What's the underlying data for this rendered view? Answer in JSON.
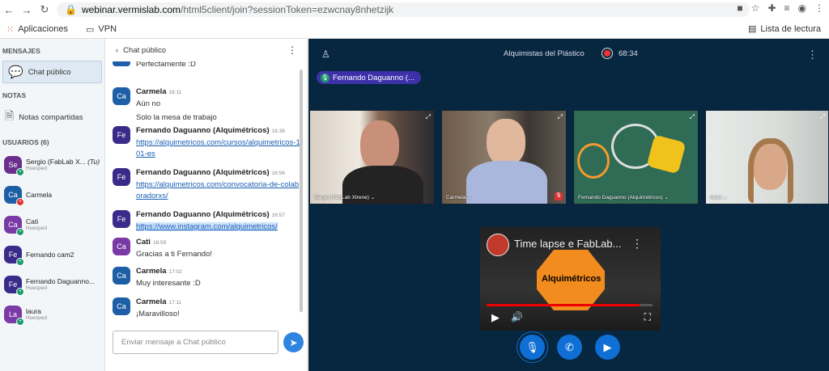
{
  "browser": {
    "url_host": "webinar.vermislab.com",
    "url_path": "/html5client/join?sessionToken=ezwcnay8nhetzijk",
    "bookmarks": [
      "Aplicaciones",
      "VPN"
    ],
    "reading_list": "Lista de lectura"
  },
  "sidebar": {
    "messages_title": "MENSAJES",
    "public_chat": "Chat público",
    "notes_title": "NOTAS",
    "shared_notes": "Notas compartidas",
    "users_title": "USUARIOS (6)",
    "users": [
      {
        "initials": "Se",
        "name": "Sergio (FabLab X...",
        "you": "(Tu)",
        "role": "Huesped",
        "color": "#6a2f8c"
      },
      {
        "initials": "Ca",
        "name": "Carmela",
        "role": "",
        "color": "#1d5fa6"
      },
      {
        "initials": "Ca",
        "name": "Cati",
        "role": "Huesped",
        "color": "#7a3aa6"
      },
      {
        "initials": "Fe",
        "name": "Fernando cam2",
        "role": "",
        "color": "#3a2b8a"
      },
      {
        "initials": "Fe",
        "name": "Fernando Daguanno...",
        "role": "Huesped",
        "color": "#3a2b8a"
      },
      {
        "initials": "La",
        "name": "laura",
        "role": "Huesped",
        "color": "#7a3aa6"
      }
    ]
  },
  "chat": {
    "title": "Chat público",
    "placeholder": "Enviar mensaje a Chat público",
    "messages": [
      {
        "initials": "",
        "name": "",
        "time": "",
        "lines": [
          "Perfectamente :D"
        ]
      },
      {
        "initials": "Ca",
        "name": "Carmela",
        "time": "16:11",
        "lines": [
          "Aún no",
          "Solo la mesa de trabajo"
        ]
      },
      {
        "initials": "Fe",
        "name": "Fernando Daguanno (Alquimétricos)",
        "time": "16:36",
        "link": "https://alquimetricos.com/cursos/alquimetricos-101-es"
      },
      {
        "initials": "Fe",
        "name": "Fernando Daguanno (Alquimétricos)",
        "time": "16:56",
        "link": "https://alquimetricos.com/convocatoria-de-colaboradorxs/"
      },
      {
        "initials": "Fe",
        "name": "Fernando Daguanno (Alquimétricos)",
        "time": "16:57",
        "link": "https://www.instagram.com/alquimetricos/"
      },
      {
        "initials": "Ca",
        "name": "Cati",
        "time": "16:59",
        "lines": [
          "Gracias a ti Fernando!"
        ]
      },
      {
        "initials": "Ca",
        "name": "Carmela",
        "time": "17:02",
        "lines": [
          "Muy interesante :D"
        ]
      },
      {
        "initials": "Ca",
        "name": "Carmela",
        "time": "17:11",
        "lines": [
          "¡Maravilloso!"
        ]
      }
    ]
  },
  "meeting": {
    "title": "Alquimistas del Plástico",
    "timer": "68:34",
    "presenter": "Fernando Daguanno (...",
    "tiles": [
      "Sergio (FabLab Xtrene) ⌄",
      "Carmela ⌄",
      "Fernando Daguanno (Alquimétricos) ⌄",
      "laura ⌄"
    ],
    "video_title": "Time lapse e FabLab...",
    "video_logo": "Alquimétricos",
    "video_progress": 0.92
  },
  "colors": {
    "accent": "#0f6fd5",
    "bg": "#07263f",
    "presenter": "#3d31a9"
  }
}
